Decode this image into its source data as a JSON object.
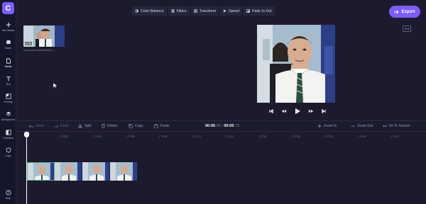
{
  "app": {
    "logo_letter": "C",
    "accent": "#7c5cff"
  },
  "sidebar": {
    "items": [
      {
        "label": "Add Media",
        "icon": "plus-icon"
      },
      {
        "label": "Stock",
        "icon": "database-icon"
      },
      {
        "label": "Media",
        "icon": "file-icon"
      },
      {
        "label": "Text",
        "icon": "text-icon"
      },
      {
        "label": "Overlay",
        "icon": "overlay-icon"
      },
      {
        "label": "Background",
        "icon": "layers-icon"
      },
      {
        "label": "Transition",
        "icon": "transition-icon"
      },
      {
        "label": "Logo",
        "icon": "shield-icon"
      }
    ],
    "help_label": "Help"
  },
  "media": {
    "caption": "funny-face-workaholics ...",
    "duration": "0:05"
  },
  "toolbar": {
    "buttons": [
      "Color Balance",
      "Filters",
      "Transform",
      "Speed",
      "Fade In Out"
    ],
    "export_label": "Export"
  },
  "preview": {
    "ratio": "1:1"
  },
  "timeline": {
    "undo": "Undo",
    "redo": "Redo",
    "split": "Split",
    "delete": "Delete",
    "copy": "Copy",
    "paste": "Paste",
    "current_time": "00:00",
    "current_frac": ".00",
    "separator": " / ",
    "total_time": "00:05",
    "total_frac": ".73",
    "zoom_in": "Zoom In",
    "zoom_out": "Zoom Out",
    "fit": "Fit To Screen",
    "ticks": [
      "0:02",
      "0:04",
      "0:06",
      "0:08",
      "0:10",
      "0:12",
      "0:14",
      "0:16",
      "0:18",
      "0:20",
      "0:22"
    ]
  }
}
